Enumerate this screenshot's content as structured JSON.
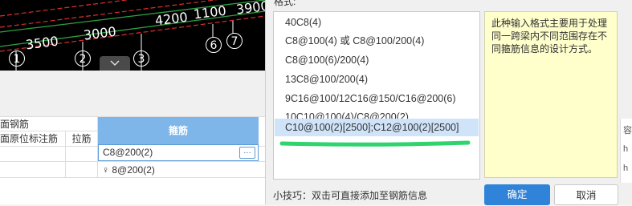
{
  "cad": {
    "dims": [
      "3500",
      "3000",
      "4200",
      "1100",
      "3900"
    ],
    "axis_labels": [
      "1",
      "2",
      "3",
      "6",
      "7"
    ]
  },
  "table": {
    "group_header": "面钢筋",
    "col_original": "面原位标注筋",
    "col_tie": "拉筋",
    "col_stirrup": "箍筋",
    "row1_stirrup": "C8@200(2)",
    "row2_stirrup": "♀ 8@200(2)",
    "more_button": "…"
  },
  "dialog": {
    "format_label": "格式:",
    "options": [
      "40C8(4)",
      "C8@100(4) 或 C8@100/200(4)",
      "C8@100(6)/200(4)",
      "13C8@100/200(4)",
      "9C16@100/12C16@150/C16@200(6)",
      "10C10@100(4)/C8@200(2)",
      "C10@100(2)[2500];C12@100(2)[2500]"
    ],
    "selected_index": 6,
    "description": "此种输入格式主要用于处理同一跨梁内不同范围存在不同箍筋信息的设计方式。",
    "tip": "小技巧：双击可直接添加至钢筋信息",
    "ok_label": "确定",
    "cancel_label": "取消",
    "annotation_color": "#2fd46e"
  }
}
